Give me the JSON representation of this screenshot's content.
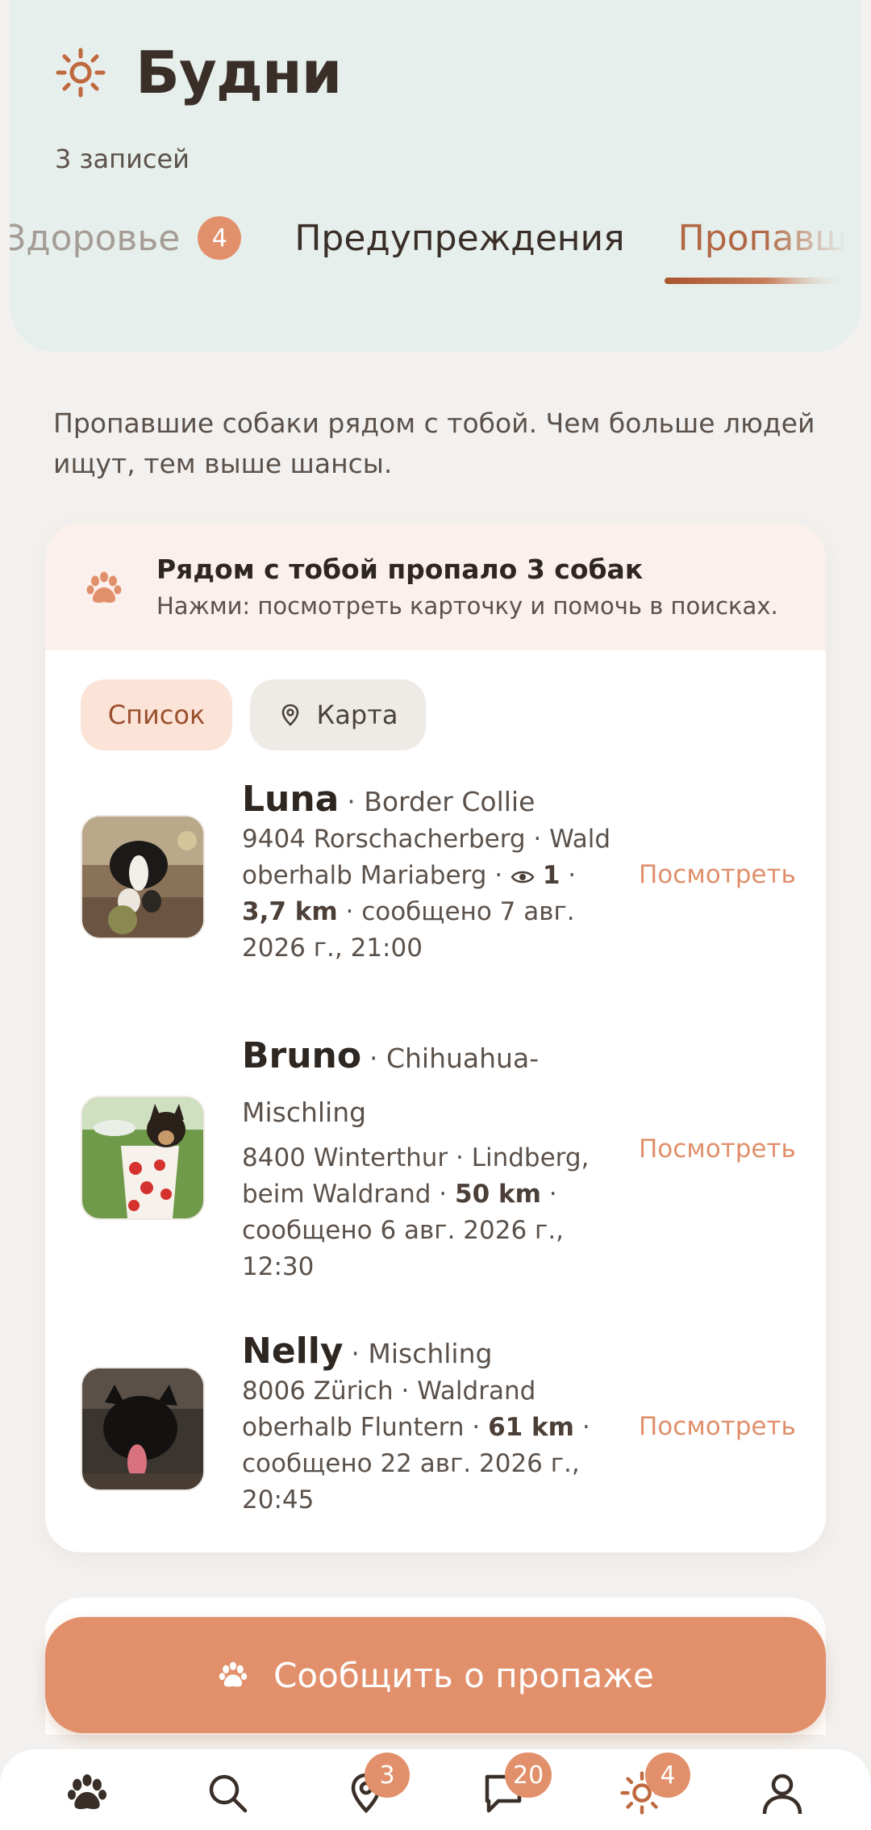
{
  "header": {
    "title": "Будни",
    "subtitle": "3 записей",
    "tabs": [
      {
        "label": "Здоровье",
        "badge": "4"
      },
      {
        "label": "Предупреждения"
      },
      {
        "label": "Пропавшие"
      }
    ]
  },
  "intro": "Пропавшие собаки рядом с тобой. Чем больше людей ищут, тем выше шансы.",
  "banner": {
    "title": "Рядом с тобой пропало 3 собак",
    "subtitle": "Нажми: посмотреть карточку и помочь в поисках."
  },
  "view_toggle": {
    "list": "Список",
    "map": "Карта"
  },
  "dogs": [
    {
      "name": "Luna",
      "breed": "· Border Collie",
      "location": "9404 Rorschacherberg · Wald oberhalb Mariaberg ·",
      "views": "1",
      "distance": "3,7 km",
      "reported": "· сообщено 7 авг. 2026 г., 21:00",
      "action": "Посмотреть"
    },
    {
      "name": "Bruno",
      "breed": "· Chihuahua-Mischling",
      "location": "8400 Winterthur · Lindberg, beim Waldrand ·",
      "distance": "50 km",
      "reported": "· сообщено 6 авг. 2026 г., 12:30",
      "action": "Посмотреть"
    },
    {
      "name": "Nelly",
      "breed": "· Mischling",
      "location": "8006 Zürich · Waldrand oberhalb Fluntern ·",
      "distance": "61 km",
      "reported": "· сообщено 22 авг. 2026 г., 20:45",
      "action": "Посмотреть"
    }
  ],
  "report_button": "Сообщить о пропаже",
  "bottom_nav": {
    "items": [
      {
        "icon": "paw-icon"
      },
      {
        "icon": "search-icon"
      },
      {
        "icon": "map-pin-icon",
        "badge": "3"
      },
      {
        "icon": "chat-icon",
        "badge": "20"
      },
      {
        "icon": "sun-icon",
        "badge": "4"
      },
      {
        "icon": "profile-icon"
      }
    ]
  },
  "colors": {
    "accent": "#e2906b",
    "header_bg": "#e6efeb",
    "active_tab": "#b26744"
  }
}
